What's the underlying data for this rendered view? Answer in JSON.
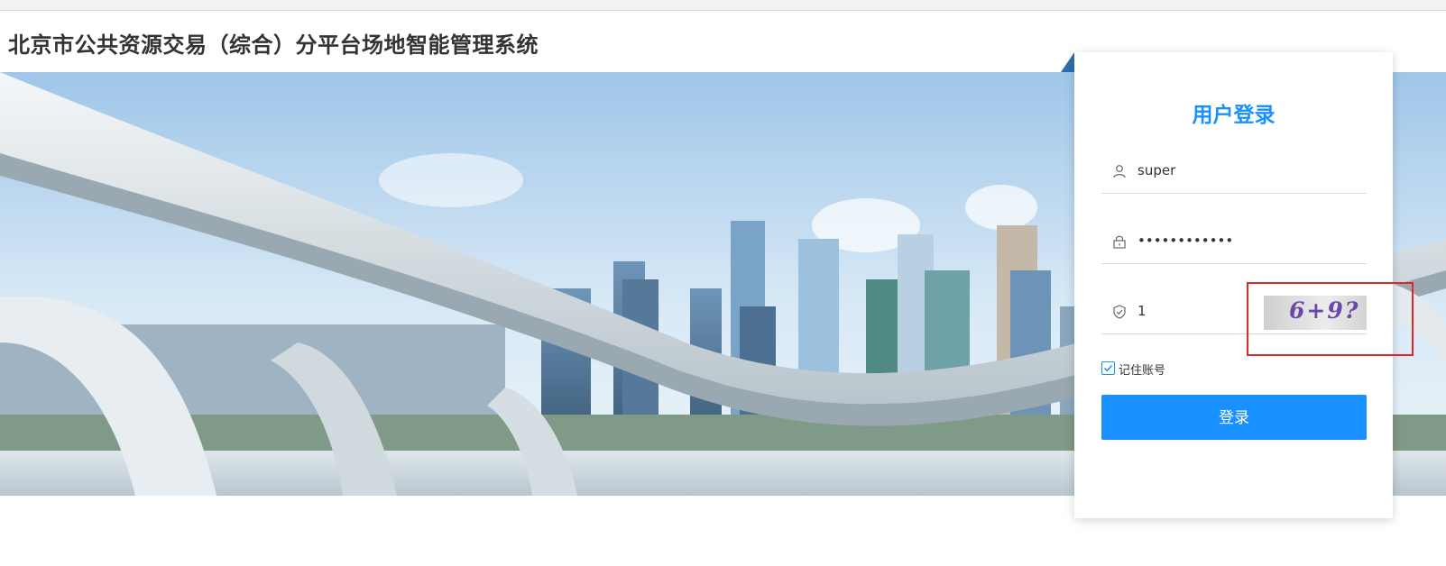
{
  "header": {
    "title": "北京市公共资源交易（综合）分平台场地智能管理系统"
  },
  "login": {
    "title": "用户登录",
    "username": "super",
    "password": "••••••••••••",
    "captcha_input": "1",
    "captcha_text": "6+9?",
    "remember_label": "记住账号",
    "remember_checked": true,
    "submit_label": "登录"
  },
  "icons": {
    "username": "user-icon",
    "password": "lock-icon",
    "captcha": "shield-check-icon",
    "remember": "checkbox-check-icon"
  },
  "colors": {
    "accent": "#1890ff",
    "highlight": "#e0262a",
    "title_text": "#333333"
  }
}
